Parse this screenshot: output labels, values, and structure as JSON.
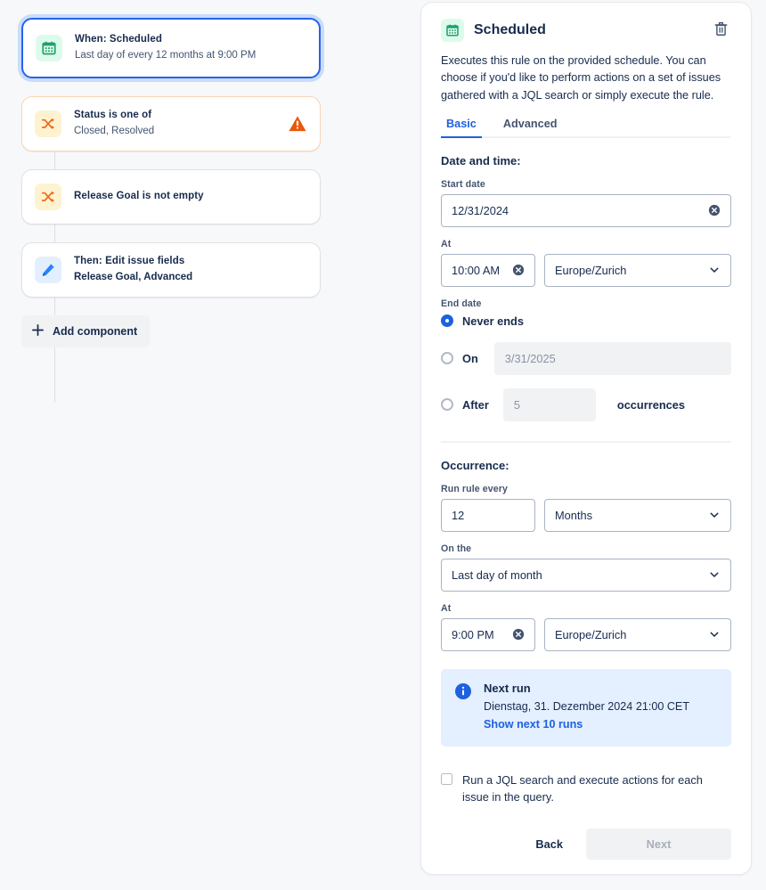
{
  "colors": {
    "accent": "#1d61e0",
    "selected_border": "#2563eb",
    "selected_glow": "#c9dcfb",
    "warn": "#e8590c",
    "green": "#22a06b",
    "green_bg": "#ddfbec",
    "amber_bg": "#fdf3d0",
    "blue_bg": "#e3efff",
    "pencil_blue": "#2684ff",
    "page_bg": "#f7f8f9",
    "info_bg": "#e4efff",
    "text": "#172b4d",
    "subtle_text": "#44546f"
  },
  "rule_chain": {
    "nodes": [
      {
        "icon": "calendar-icon",
        "tile": "green",
        "title": "When: Scheduled",
        "subtitle": "Last day of every 12 months at 9:00 PM",
        "selected": true,
        "warning": false
      },
      {
        "icon": "shuffle-icon",
        "tile": "amber",
        "title": "Status is one of",
        "subtitle": "Closed, Resolved",
        "selected": false,
        "warning": true
      },
      {
        "icon": "shuffle-icon",
        "tile": "amber",
        "title": "Release Goal is not empty",
        "subtitle": "",
        "selected": false,
        "warning": false
      },
      {
        "icon": "pencil-icon",
        "tile": "blue",
        "title": "Then: Edit issue fields",
        "subtitle": "Release Goal, Advanced",
        "selected": false,
        "warning": false
      }
    ],
    "add_component_label": "Add component"
  },
  "panel": {
    "icon": "calendar-icon",
    "title": "Scheduled",
    "delete_icon": "trash-icon",
    "description": "Executes this rule on the provided schedule. You can choose if you'd like to perform actions on a set of issues gathered with a JQL search or simply execute the rule.",
    "tabs": [
      {
        "label": "Basic",
        "active": true
      },
      {
        "label": "Advanced",
        "active": false
      }
    ],
    "date_and_time": {
      "heading": "Date and time:",
      "start_date_label": "Start date",
      "start_date_value": "12/31/2024",
      "at_label": "At",
      "start_time_value": "10:00 AM",
      "start_timezone_value": "Europe/Zurich",
      "end_date_label": "End date",
      "options": [
        {
          "label": "Never ends",
          "selected": true
        },
        {
          "label": "On",
          "selected": false,
          "placeholder": "3/31/2025"
        },
        {
          "label": "After",
          "selected": false,
          "placeholder": "5",
          "suffix": "occurrences"
        }
      ]
    },
    "occurrence": {
      "heading": "Occurrence:",
      "run_rule_every_label": "Run rule every",
      "interval_value": "12",
      "unit_value": "Months",
      "on_the_label": "On the",
      "on_the_value": "Last day of month",
      "at_label": "At",
      "time_value": "9:00 PM",
      "timezone_value": "Europe/Zurich"
    },
    "next_run": {
      "icon": "info-icon",
      "title": "Next run",
      "datetime": "Dienstag, 31. Dezember 2024 21:00 CET",
      "link": "Show next 10 runs"
    },
    "jql_checkbox": {
      "label": "Run a JQL search and execute actions for each issue in the query.",
      "checked": false
    },
    "footer": {
      "back_label": "Back",
      "next_label": "Next"
    }
  }
}
